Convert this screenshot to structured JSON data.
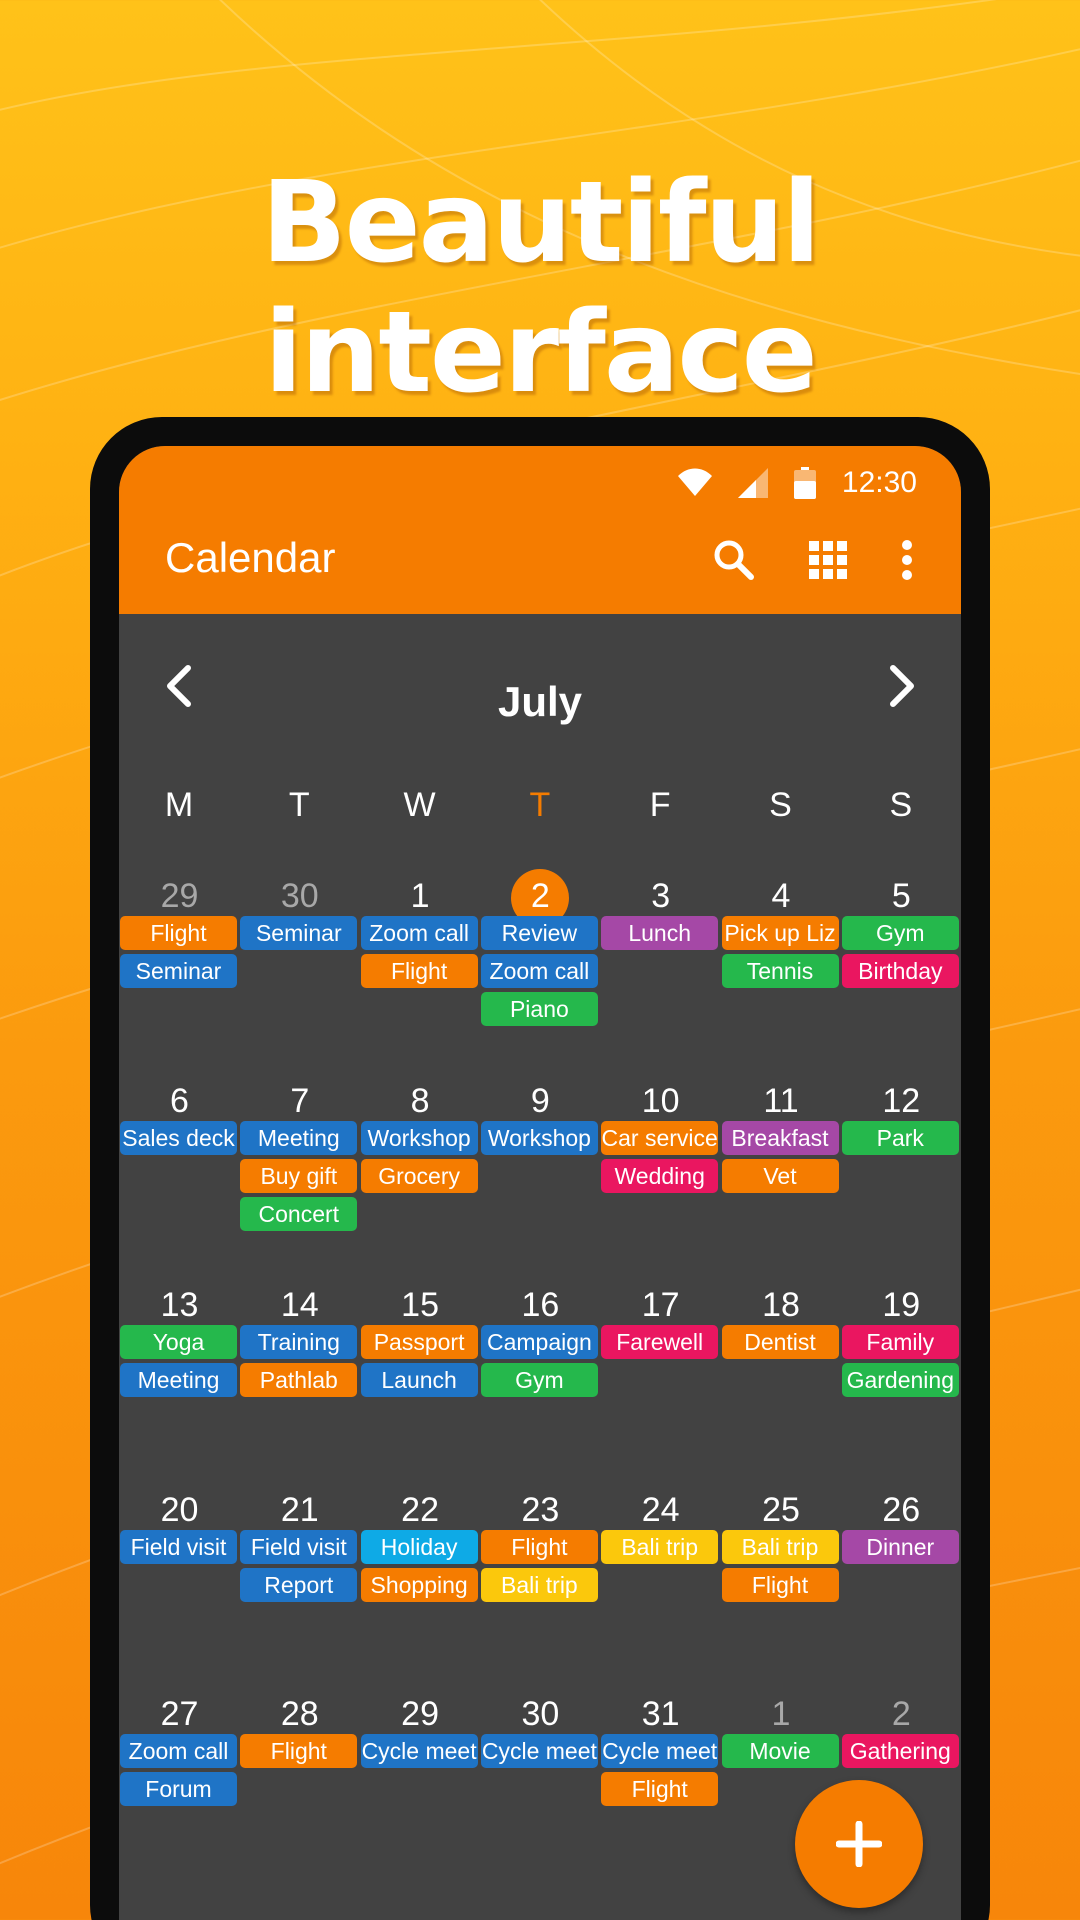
{
  "headline": "Beautiful interface",
  "status_bar": {
    "time": "12:30",
    "icons": [
      "wifi-icon",
      "signal-icon",
      "battery-icon"
    ]
  },
  "toolbar": {
    "title": "Calendar",
    "actions": [
      "search-icon",
      "grid-view-icon",
      "more-vert-icon"
    ]
  },
  "month": {
    "title": "July",
    "prev_icon": "chevron-left-icon",
    "next_icon": "chevron-right-icon"
  },
  "weekdays": [
    "M",
    "T",
    "W",
    "T",
    "F",
    "S",
    "S"
  ],
  "today_weekday_index": 3,
  "weeks": [
    {
      "days": [
        {
          "num": "29",
          "other": true,
          "events": [
            {
              "label": "Flight",
              "color": "orange"
            },
            {
              "label": "Seminar",
              "color": "blue"
            }
          ]
        },
        {
          "num": "30",
          "other": true,
          "events": [
            {
              "label": "Seminar",
              "color": "blue"
            }
          ]
        },
        {
          "num": "1",
          "events": [
            {
              "label": "Zoom call",
              "color": "blue"
            },
            {
              "label": "Flight",
              "color": "orange"
            }
          ]
        },
        {
          "num": "2",
          "today": true,
          "events": [
            {
              "label": "Review",
              "color": "blue"
            },
            {
              "label": "Zoom call",
              "color": "blue"
            },
            {
              "label": "Piano",
              "color": "green"
            }
          ]
        },
        {
          "num": "3",
          "events": [
            {
              "label": "Lunch",
              "color": "purple"
            }
          ]
        },
        {
          "num": "4",
          "events": [
            {
              "label": "Pick up Liz",
              "color": "orange"
            },
            {
              "label": "Tennis",
              "color": "green"
            }
          ]
        },
        {
          "num": "5",
          "events": [
            {
              "label": "Gym",
              "color": "green"
            },
            {
              "label": "Birthday",
              "color": "pink"
            }
          ]
        }
      ]
    },
    {
      "days": [
        {
          "num": "6",
          "events": [
            {
              "label": "Sales deck",
              "color": "blue"
            }
          ]
        },
        {
          "num": "7",
          "events": [
            {
              "label": "Meeting",
              "color": "blue"
            },
            {
              "label": "Buy gift",
              "color": "orange"
            },
            {
              "label": "Concert",
              "color": "green"
            }
          ]
        },
        {
          "num": "8",
          "events": [
            {
              "label": "Workshop",
              "color": "blue"
            },
            {
              "label": "Grocery",
              "color": "orange"
            }
          ]
        },
        {
          "num": "9",
          "events": [
            {
              "label": "Workshop",
              "color": "blue"
            }
          ]
        },
        {
          "num": "10",
          "events": [
            {
              "label": "Car service",
              "color": "orange"
            },
            {
              "label": "Wedding",
              "color": "pink"
            }
          ]
        },
        {
          "num": "11",
          "events": [
            {
              "label": "Breakfast",
              "color": "purple"
            },
            {
              "label": "Vet",
              "color": "orange"
            }
          ]
        },
        {
          "num": "12",
          "events": [
            {
              "label": "Park",
              "color": "green"
            }
          ]
        }
      ]
    },
    {
      "days": [
        {
          "num": "13",
          "events": [
            {
              "label": "Yoga",
              "color": "green"
            },
            {
              "label": "Meeting",
              "color": "blue"
            }
          ]
        },
        {
          "num": "14",
          "events": [
            {
              "label": "Training",
              "color": "blue"
            },
            {
              "label": "Pathlab",
              "color": "orange"
            }
          ]
        },
        {
          "num": "15",
          "events": [
            {
              "label": "Passport",
              "color": "orange"
            },
            {
              "label": "Launch",
              "color": "blue"
            }
          ]
        },
        {
          "num": "16",
          "events": [
            {
              "label": "Campaign",
              "color": "blue"
            },
            {
              "label": "Gym",
              "color": "green"
            }
          ]
        },
        {
          "num": "17",
          "events": [
            {
              "label": "Farewell",
              "color": "pink"
            }
          ]
        },
        {
          "num": "18",
          "events": [
            {
              "label": "Dentist",
              "color": "orange"
            }
          ]
        },
        {
          "num": "19",
          "events": [
            {
              "label": "Family",
              "color": "pink"
            },
            {
              "label": "Gardening",
              "color": "green"
            }
          ]
        }
      ]
    },
    {
      "days": [
        {
          "num": "20",
          "events": [
            {
              "label": "Field visit",
              "color": "blue"
            }
          ]
        },
        {
          "num": "21",
          "events": [
            {
              "label": "Field visit",
              "color": "blue"
            },
            {
              "label": "Report",
              "color": "blue"
            }
          ]
        },
        {
          "num": "22",
          "events": [
            {
              "label": "Holiday",
              "color": "cyan"
            },
            {
              "label": "Shopping",
              "color": "orange"
            }
          ]
        },
        {
          "num": "23",
          "events": [
            {
              "label": "Flight",
              "color": "orange"
            },
            {
              "label": "Bali trip",
              "color": "yellow"
            }
          ]
        },
        {
          "num": "24",
          "events": [
            {
              "label": "Bali trip",
              "color": "yellow"
            }
          ]
        },
        {
          "num": "25",
          "events": [
            {
              "label": "Bali trip",
              "color": "yellow"
            },
            {
              "label": "Flight",
              "color": "orange"
            }
          ]
        },
        {
          "num": "26",
          "events": [
            {
              "label": "Dinner",
              "color": "purple"
            }
          ]
        }
      ]
    },
    {
      "days": [
        {
          "num": "27",
          "events": [
            {
              "label": "Zoom call",
              "color": "blue"
            },
            {
              "label": "Forum",
              "color": "blue"
            }
          ]
        },
        {
          "num": "28",
          "events": [
            {
              "label": "Flight",
              "color": "orange"
            }
          ]
        },
        {
          "num": "29",
          "events": [
            {
              "label": "Cycle meet",
              "color": "blue"
            }
          ]
        },
        {
          "num": "30",
          "events": [
            {
              "label": "Cycle meet",
              "color": "blue"
            }
          ]
        },
        {
          "num": "31",
          "events": [
            {
              "label": "Cycle meet",
              "color": "blue"
            },
            {
              "label": "Flight",
              "color": "orange"
            }
          ]
        },
        {
          "num": "1",
          "other": true,
          "events": [
            {
              "label": "Movie",
              "color": "green"
            }
          ]
        },
        {
          "num": "2",
          "other": true,
          "events": [
            {
              "label": "Gathering",
              "color": "pink"
            }
          ]
        }
      ]
    }
  ],
  "event_colors": {
    "orange": "#f57c00",
    "blue": "#1f74c6",
    "green": "#25b84c",
    "purple": "#a548a6",
    "pink": "#ea1660",
    "cyan": "#0eaae6",
    "yellow": "#fbc80c"
  },
  "theme": {
    "accent": "#f57c00",
    "background": "#424242"
  },
  "fab_icon": "plus-icon"
}
